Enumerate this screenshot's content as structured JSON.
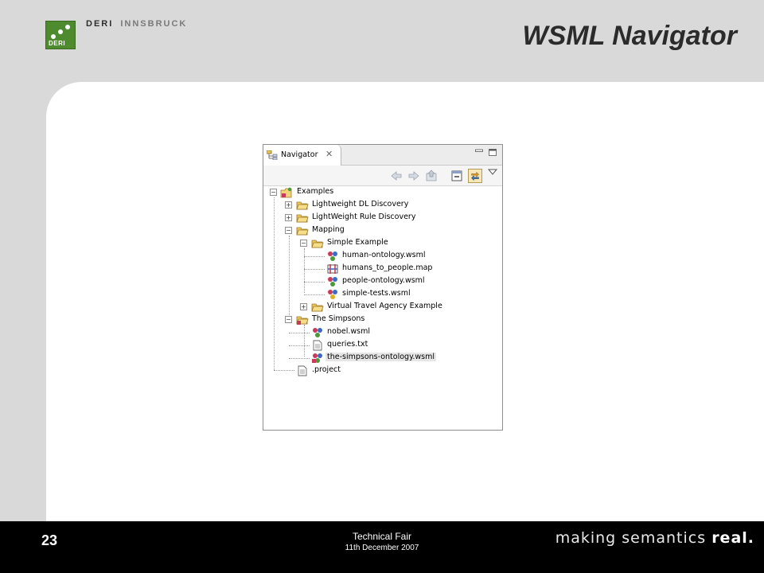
{
  "header": {
    "logo_org": "DERI",
    "logo_city": "INNSBRUCK",
    "logo_box_label": "DERI",
    "title": "WSML Navigator"
  },
  "footer": {
    "page_number": "23",
    "event_name": "Technical Fair",
    "event_date": "11th December 2007",
    "slogan_part1": "making semantics ",
    "slogan_part2": "real."
  },
  "navigator": {
    "tab_label": "Navigator",
    "tab_close_icon": "close-icon",
    "window_buttons": [
      "minimize-icon",
      "maximize-icon"
    ],
    "toolbar": [
      "back-arrow-icon",
      "forward-arrow-icon",
      "up-folder-icon",
      "collapse-all-icon",
      "link-with-editor-icon",
      "view-menu-icon"
    ],
    "tree": [
      {
        "label": "Examples",
        "icon": "project-icon",
        "expanded": true
      },
      {
        "label": "Lightweight DL Discovery",
        "icon": "folder-icon",
        "expanded": false
      },
      {
        "label": "LightWeight Rule Discovery",
        "icon": "folder-icon",
        "expanded": false
      },
      {
        "label": "Mapping",
        "icon": "folder-icon",
        "expanded": true
      },
      {
        "label": "Simple Example",
        "icon": "folder-icon",
        "expanded": true
      },
      {
        "label": "human-ontology.wsml",
        "icon": "wsml-file-icon"
      },
      {
        "label": "humans_to_people.map",
        "icon": "map-file-icon"
      },
      {
        "label": "people-ontology.wsml",
        "icon": "wsml-file-icon"
      },
      {
        "label": "simple-tests.wsml",
        "icon": "wsml-file-icon"
      },
      {
        "label": "Virtual Travel Agency Example",
        "icon": "folder-icon",
        "expanded": false
      },
      {
        "label": "The Simpsons",
        "icon": "folder-icon",
        "expanded": true
      },
      {
        "label": "nobel.wsml",
        "icon": "wsml-file-icon"
      },
      {
        "label": "queries.txt",
        "icon": "text-file-icon"
      },
      {
        "label": "the-simpsons-ontology.wsml",
        "icon": "wsml-file-icon",
        "selected": true
      },
      {
        "label": ".project",
        "icon": "text-file-icon"
      }
    ]
  }
}
